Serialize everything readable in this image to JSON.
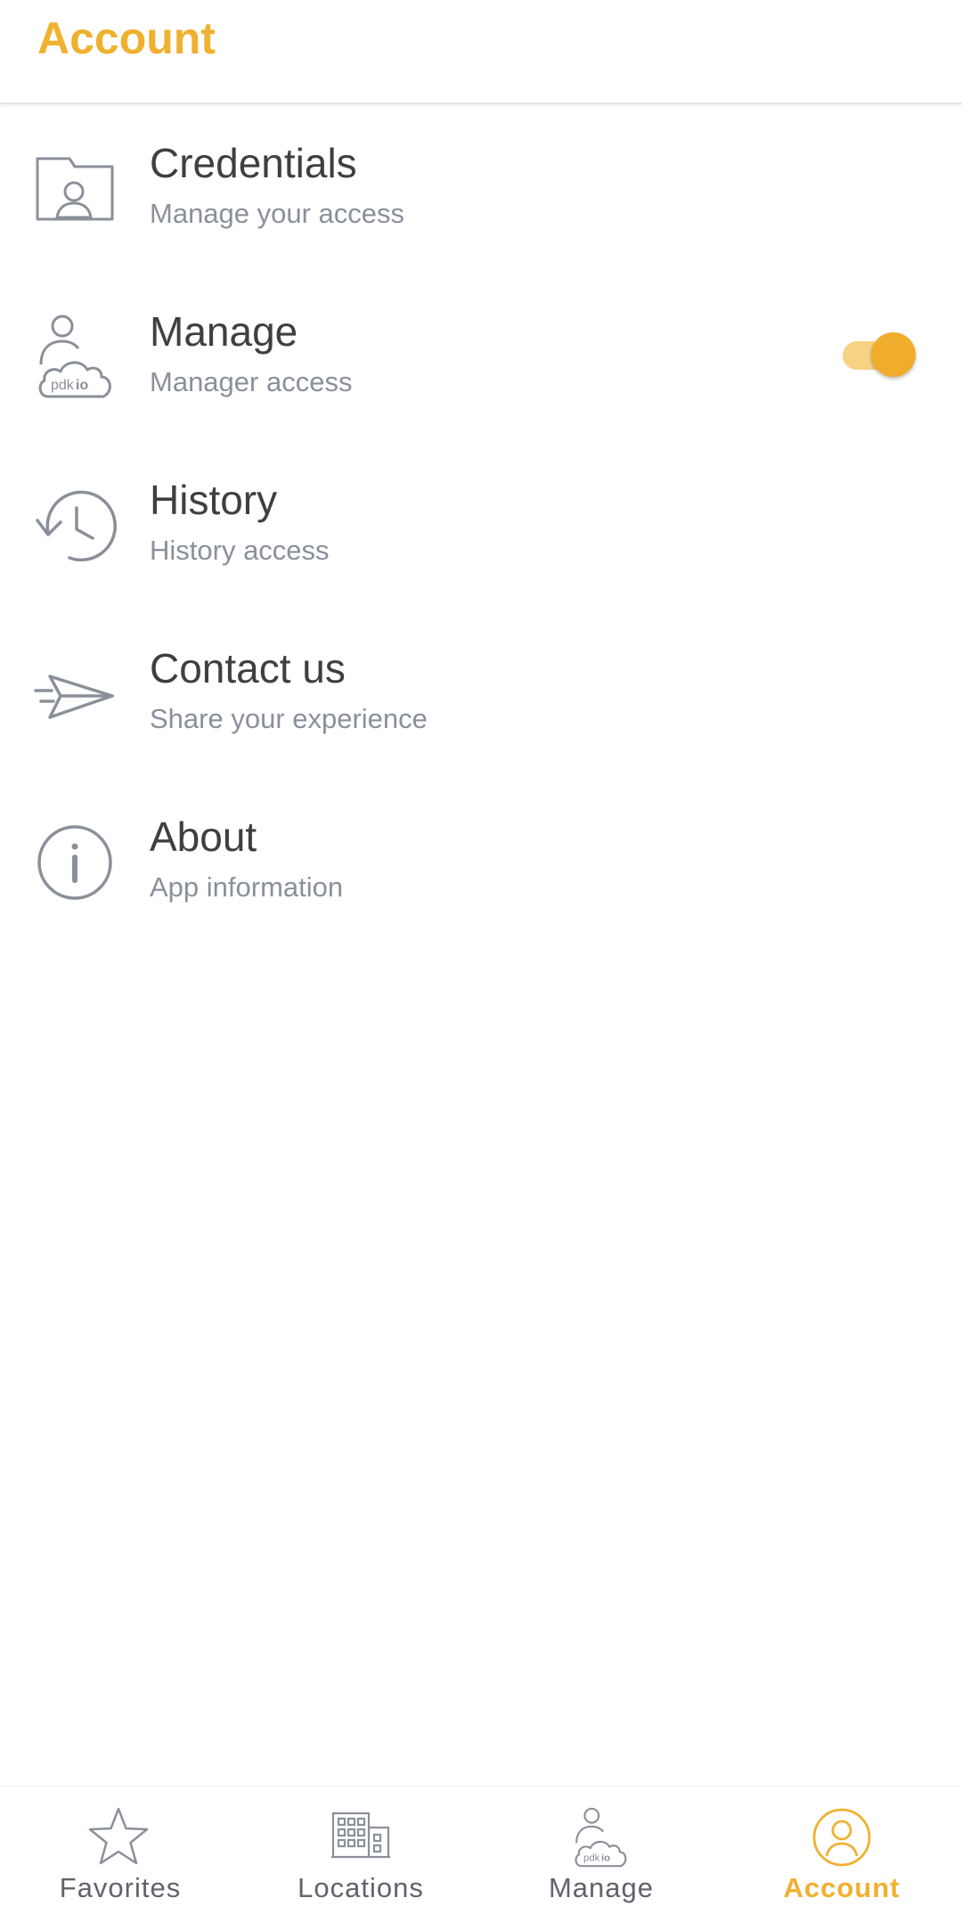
{
  "header": {
    "title": "Account"
  },
  "colors": {
    "accent": "#f0b130",
    "icon_gray": "#8a909a",
    "text_dark": "#3d3f42"
  },
  "menu": [
    {
      "title": "Credentials",
      "subtitle": "Manage your access",
      "icon": "credential-folder-icon"
    },
    {
      "title": "Manage",
      "subtitle": "Manager access",
      "icon": "pdkio-user-cloud-icon",
      "toggle_on": true
    },
    {
      "title": "History",
      "subtitle": "History access",
      "icon": "history-clock-icon"
    },
    {
      "title": "Contact us",
      "subtitle": "Share your experience",
      "icon": "paper-plane-icon"
    },
    {
      "title": "About",
      "subtitle": "App information",
      "icon": "info-icon"
    }
  ],
  "icon_text": {
    "pdk": "pdk",
    "io": "io"
  },
  "bottom_nav": [
    {
      "label": "Favorites",
      "icon": "star-icon",
      "active": false
    },
    {
      "label": "Locations",
      "icon": "building-icon",
      "active": false
    },
    {
      "label": "Manage",
      "icon": "pdkio-user-cloud-icon",
      "active": false
    },
    {
      "label": "Account",
      "icon": "account-circle-icon",
      "active": true
    }
  ]
}
